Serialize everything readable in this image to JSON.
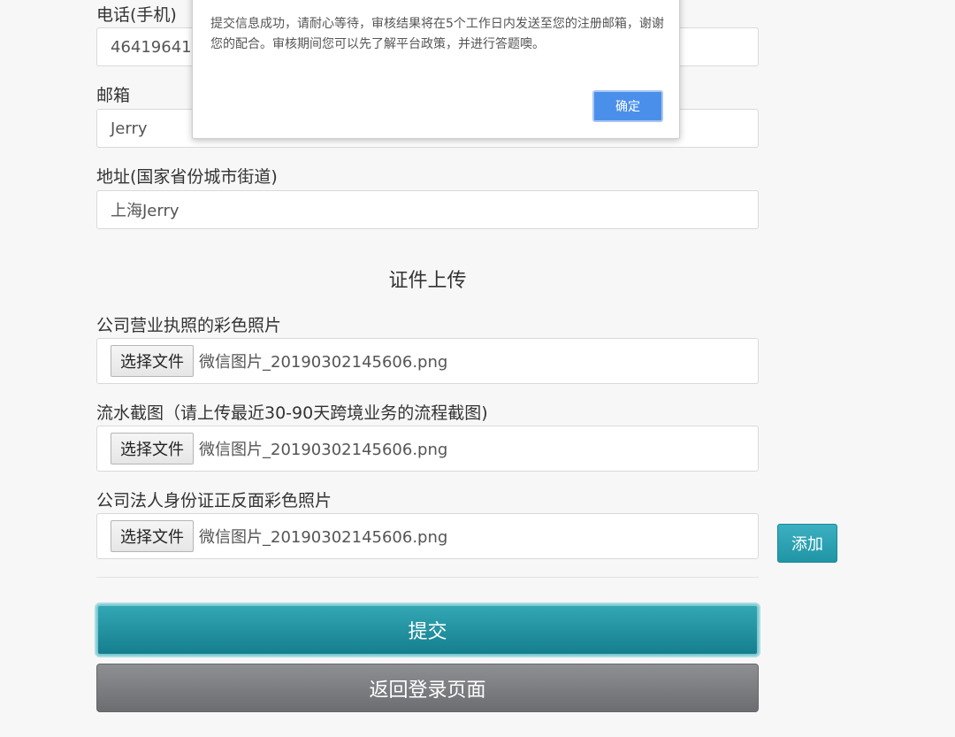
{
  "form": {
    "phone": {
      "label": "电话(手机)",
      "value": "4641964164"
    },
    "email": {
      "label": "邮箱",
      "value": "Jerry"
    },
    "address": {
      "label": "地址(国家省份城市街道)",
      "value": "上海Jerry"
    }
  },
  "upload_section": {
    "title": "证件上传",
    "items": [
      {
        "label": "公司营业执照的彩色照片",
        "button": "选择文件",
        "filename": "微信图片_20190302145606.png"
      },
      {
        "label": "流水截图（请上传最近30-90天跨境业务的流程截图)",
        "button": "选择文件",
        "filename": "微信图片_20190302145606.png"
      },
      {
        "label": "公司法人身份证正反面彩色照片",
        "button": "选择文件",
        "filename": "微信图片_20190302145606.png"
      }
    ],
    "add_label": "添加"
  },
  "actions": {
    "submit_label": "提交",
    "back_label": "返回登录页面"
  },
  "dialog": {
    "message": "提交信息成功，请耐心等待，审核结果将在5个工作日内发送至您的注册邮箱，谢谢您的配合。审核期间您可以先了解平台政策，并进行答题噢。",
    "ok_label": "确定"
  },
  "colors": {
    "submit": "#1f95a6",
    "back": "#7c7d81",
    "dialog_ok": "#4a8fea",
    "add": "#2aa3b3"
  }
}
